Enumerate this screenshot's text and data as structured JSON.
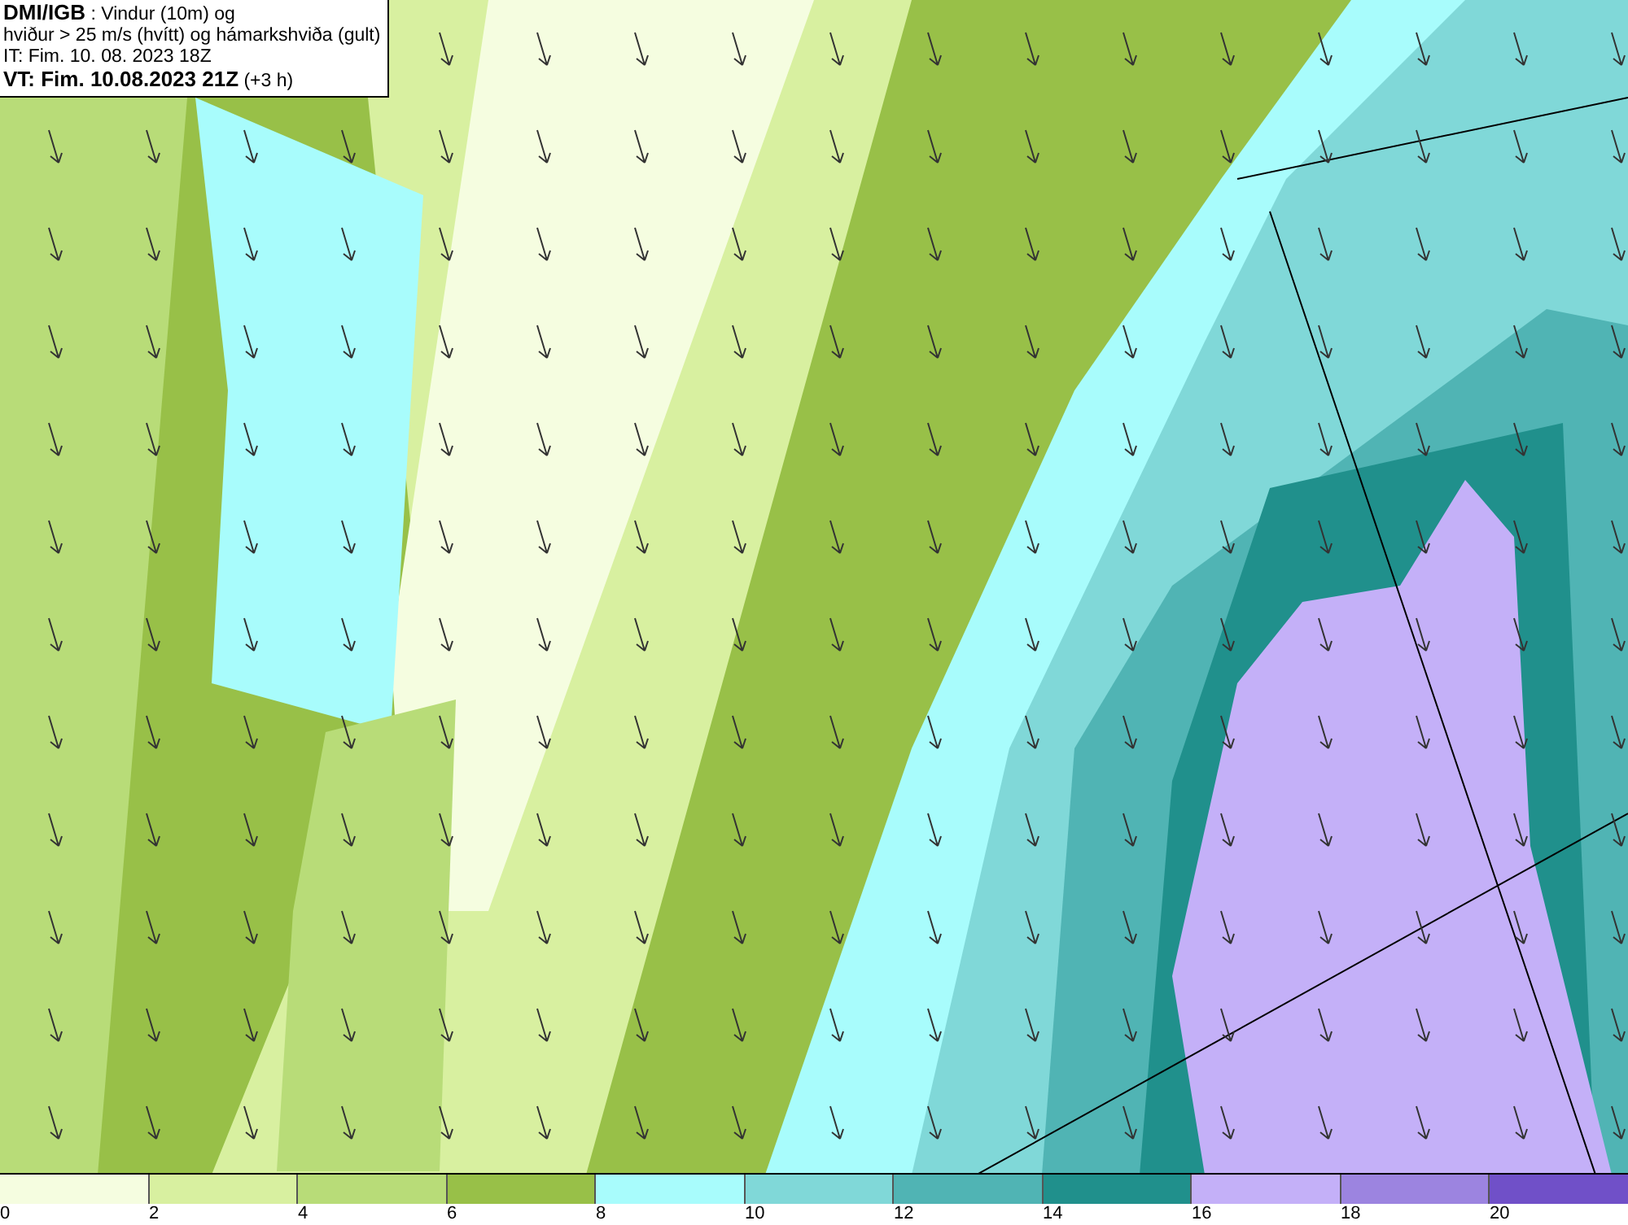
{
  "title_box": {
    "lines": [
      "**DMI/IGB** : Vindur (10m) og",
      "hviður > 25 m/s (hvítt) og hámarkshviða (gult)",
      "IT: Fim. 10. 08. 2023 18Z",
      "**VT: Fim. 10.08.2023 21Z** (+3 h)"
    ]
  },
  "legend": [
    {
      "label": "0",
      "color": "#f5fde0"
    },
    {
      "label": "2",
      "color": "#d8f0a0"
    },
    {
      "label": "4",
      "color": "#b8dc78"
    },
    {
      "label": "6",
      "color": "#98c048"
    },
    {
      "label": "8",
      "color": "#a8fcfc"
    },
    {
      "label": "10",
      "color": "#80d8d8"
    },
    {
      "label": "12",
      "color": "#50b4b4"
    },
    {
      "label": "14",
      "color": "#20908c"
    },
    {
      "label": "16",
      "color": "#c4b0f8"
    },
    {
      "label": "18",
      "color": "#9c84e0"
    },
    {
      "label": "20",
      "color": "#7050c8"
    }
  ]
}
